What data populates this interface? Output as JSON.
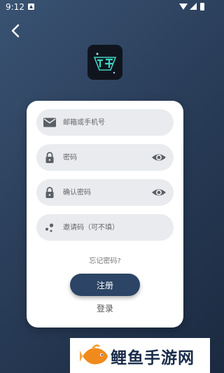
{
  "status_bar": {
    "time": "9:12"
  },
  "form": {
    "email_placeholder": "邮箱或手机号",
    "password_placeholder": "密码",
    "confirm_password_placeholder": "确认密码",
    "invite_placeholder": "邀请码（可不填）",
    "forgot_label": "忘记密码?",
    "register_label": "注册",
    "login_label": "登录"
  },
  "watermark": {
    "text": "鲤鱼手游网"
  },
  "colors": {
    "button": "#2c4465",
    "background": "#2a3e5a",
    "field": "#e9ebee"
  }
}
